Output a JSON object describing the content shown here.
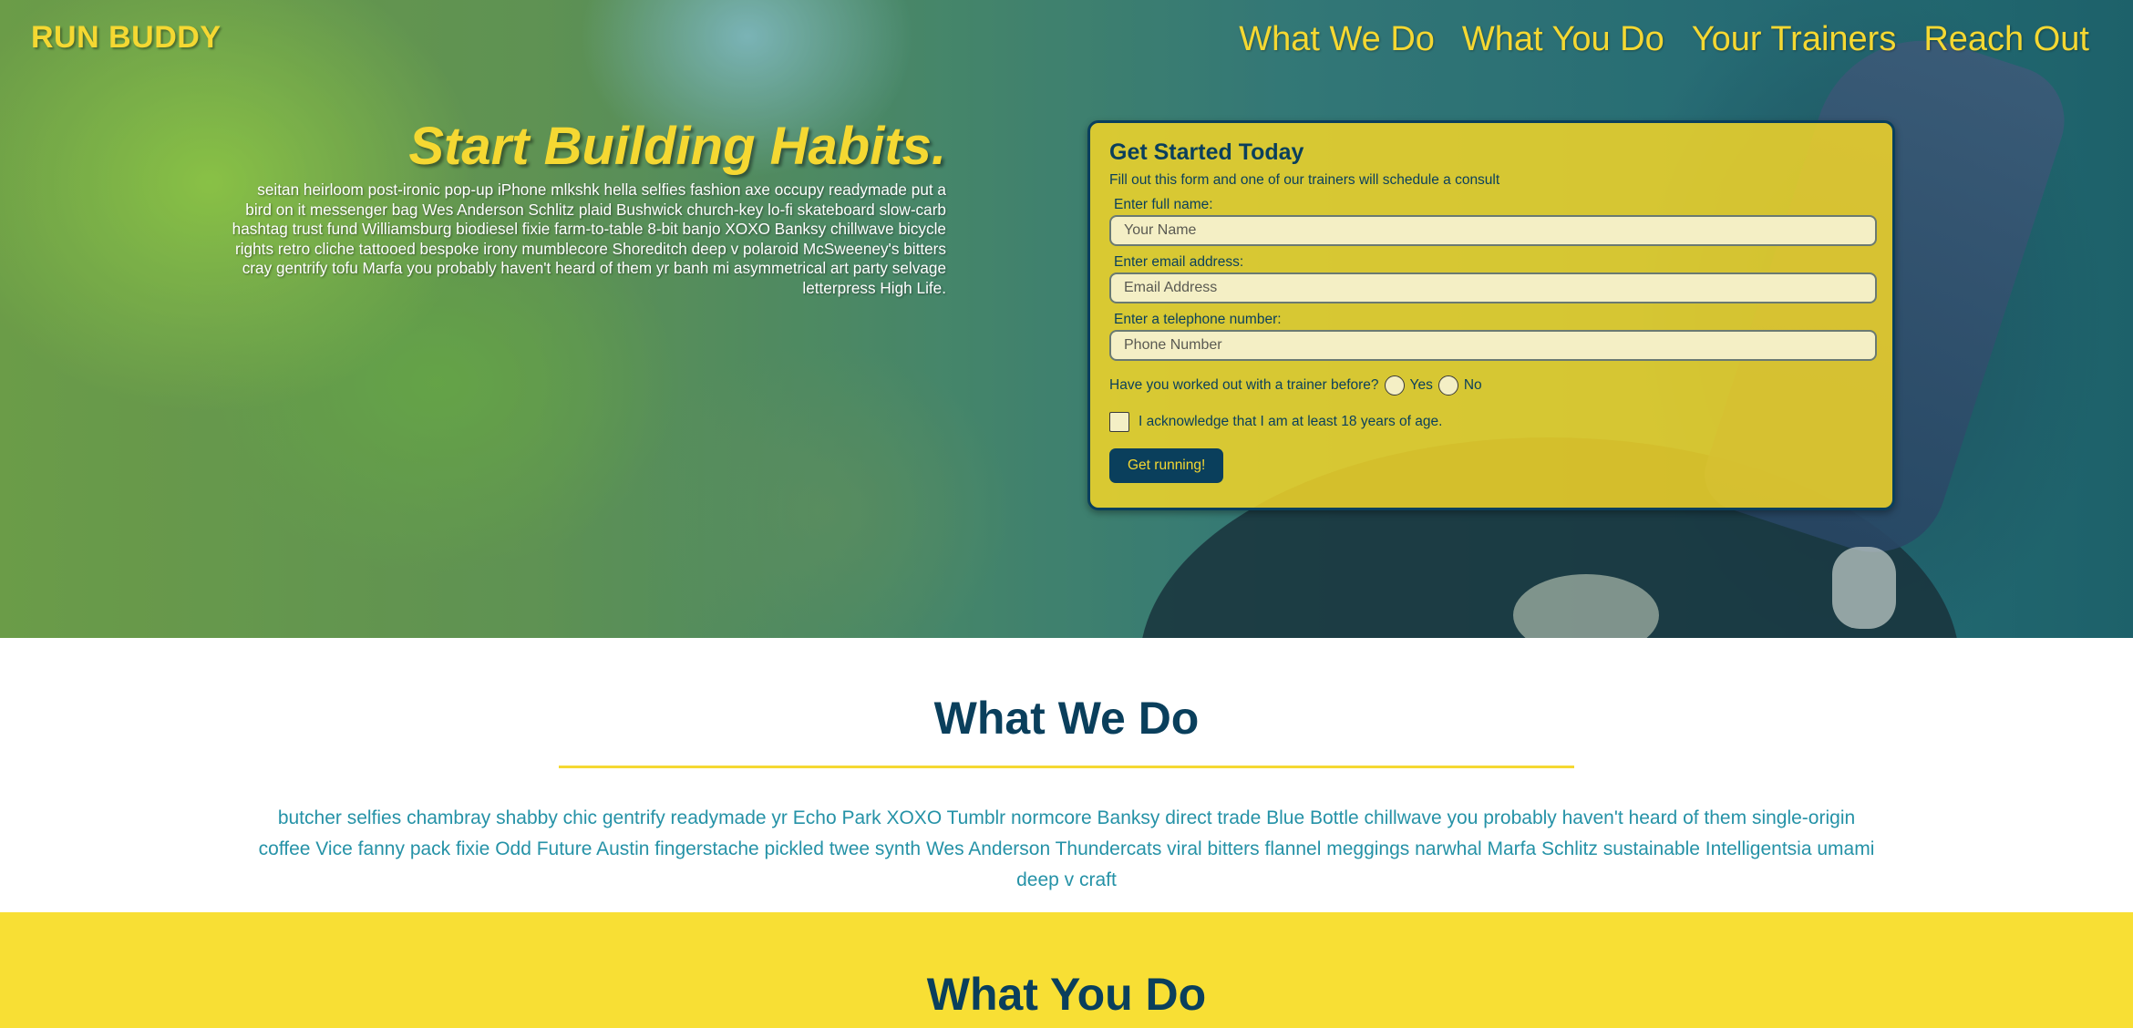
{
  "header": {
    "logo": "RUN BUDDY",
    "nav": [
      "What We Do",
      "What You Do",
      "Your Trainers",
      "Reach Out"
    ]
  },
  "hero": {
    "title": "Start Building Habits.",
    "body": "seitan heirloom post-ironic pop-up iPhone mlkshk hella selfies fashion axe occupy readymade put a bird on it messenger bag Wes Anderson Schlitz plaid Bushwick church-key lo-fi skateboard slow-carb hashtag trust fund Williamsburg biodiesel fixie farm-to-table 8-bit banjo XOXO Banksy chillwave bicycle rights retro cliche tattooed bespoke irony mumblecore Shoreditch deep v polaroid McSweeney's bitters cray gentrify tofu Marfa you probably haven't heard of them yr banh mi asymmetrical art party selvage letterpress High Life."
  },
  "form": {
    "title": "Get Started Today",
    "subtitle": "Fill out this form and one of our trainers will schedule a consult",
    "name_label": "Enter full name:",
    "name_placeholder": "Your Name",
    "email_label": "Enter email address:",
    "email_placeholder": "Email Address",
    "phone_label": "Enter a telephone number:",
    "phone_placeholder": "Phone Number",
    "trainer_question": "Have you worked out with a trainer before?",
    "option_yes": "Yes",
    "option_no": "No",
    "age_ack": "I acknowledge that I am at least 18 years of age.",
    "submit_label": "Get running!"
  },
  "what_we_do": {
    "title": "What We Do",
    "body": "butcher selfies chambray shabby chic gentrify readymade yr Echo Park XOXO Tumblr normcore Banksy direct trade Blue Bottle chillwave you probably haven't heard of them single-origin coffee Vice fanny pack fixie Odd Future Austin fingerstache pickled twee synth Wes Anderson Thundercats viral bitters flannel meggings narwhal Marfa Schlitz sustainable Intelligentsia umami deep v craft"
  },
  "what_you_do": {
    "title": "What You Do"
  },
  "colors": {
    "accent_yellow": "#f5d832",
    "navy": "#0a3f5c",
    "teal_text": "#2592a7"
  }
}
